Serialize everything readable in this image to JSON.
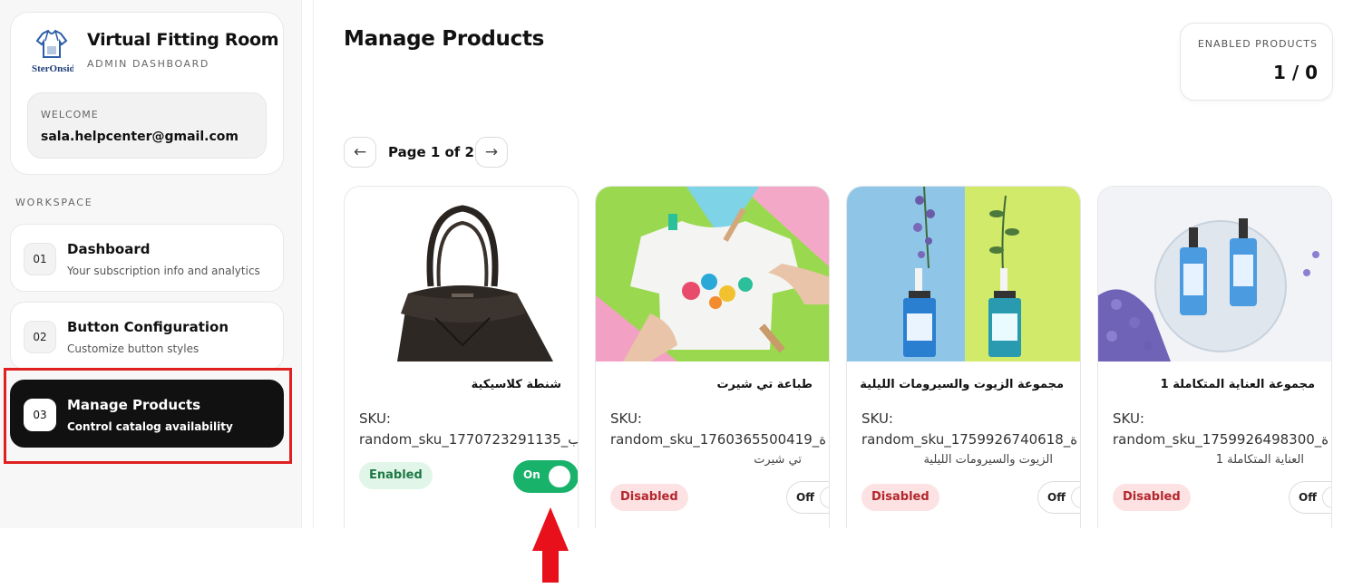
{
  "sidebar": {
    "logo_text": "SterOnside",
    "app_title": "Virtual Fitting Room",
    "app_subtitle": "ADMIN DASHBOARD",
    "welcome_label": "WELCOME",
    "welcome_email": "sala.helpcenter@gmail.com",
    "workspace_label": "WORKSPACE",
    "nav": [
      {
        "num": "01",
        "title": "Dashboard",
        "subtitle": "Your subscription info and analytics",
        "active": false
      },
      {
        "num": "02",
        "title": "Button Configuration",
        "subtitle": "Customize button styles",
        "active": false
      },
      {
        "num": "03",
        "title": "Manage Products",
        "subtitle": "Control catalog availability",
        "active": true
      }
    ]
  },
  "main": {
    "title": "Manage Products",
    "stat": {
      "label": "ENABLED PRODUCTS",
      "value": "1 / 0"
    },
    "pager": {
      "prev": "←",
      "text": "Page 1 of 2",
      "next": "→"
    },
    "products": [
      {
        "name": "شنطة كلاسيكية",
        "sku_label": "SKU:",
        "sku": "random_sku_1770723291135_ب",
        "sku_sub": "",
        "status": "Enabled",
        "toggle": "On",
        "enabled": true
      },
      {
        "name": "طباعة تي شيرت",
        "sku_label": "SKU:",
        "sku": "random_sku_1760365500419_ة",
        "sku_sub": "تي شيرت",
        "status": "Disabled",
        "toggle": "Off",
        "enabled": false
      },
      {
        "name": "مجموعة الزيوت والسيرومات الليلية",
        "sku_label": "SKU:",
        "sku": "random_sku_1759926740618_ة",
        "sku_sub": "الزيوت والسيرومات الليلية",
        "status": "Disabled",
        "toggle": "Off",
        "enabled": false
      },
      {
        "name": "مجموعة العناية المتكاملة 1",
        "sku_label": "SKU:",
        "sku": "random_sku_1759926498300_ة",
        "sku_sub": "العناية المتكاملة 1",
        "status": "Disabled",
        "toggle": "Off",
        "enabled": false
      }
    ]
  },
  "colors": {
    "accent_green": "#18b26b",
    "annotation_red": "#e02020",
    "active_nav": "#111111"
  }
}
